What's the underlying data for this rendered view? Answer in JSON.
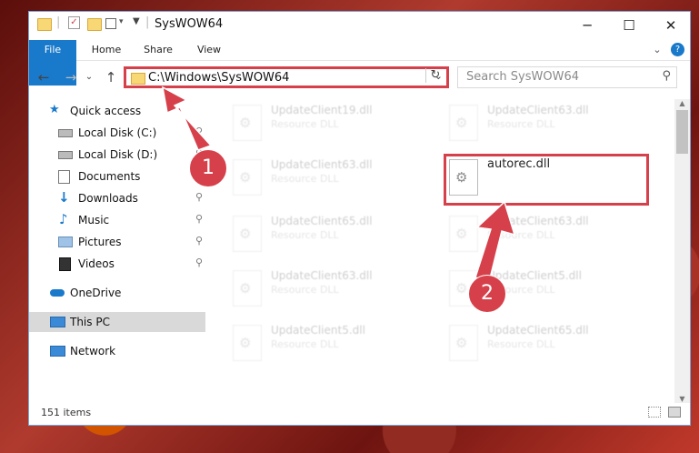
{
  "window": {
    "title": "SysWOW64",
    "minimize": "─",
    "maximize": "☐",
    "close": "✕"
  },
  "ribbon": {
    "tabs": [
      "File",
      "Home",
      "Share",
      "View"
    ],
    "collapse": "⌄",
    "help": "?"
  },
  "nav": {
    "back": "←",
    "forward": "→",
    "recent": "⌄",
    "up": "↑",
    "address": "C:\\Windows\\SysWOW64",
    "address_dropdown": "⌄",
    "refresh": "↻",
    "search_placeholder": "Search SysWOW64",
    "search_icon": "⚲"
  },
  "sidebar": {
    "items": [
      {
        "label": "Quick access",
        "icon": "star-icon"
      },
      {
        "label": "Local Disk (C:)",
        "icon": "drive-icon"
      },
      {
        "label": "Local Disk (D:)",
        "icon": "drive-icon"
      },
      {
        "label": "Documents",
        "icon": "documents-icon"
      },
      {
        "label": "Downloads",
        "icon": "download-icon"
      },
      {
        "label": "Music",
        "icon": "music-icon"
      },
      {
        "label": "Pictures",
        "icon": "pictures-icon"
      },
      {
        "label": "Videos",
        "icon": "videos-icon"
      },
      {
        "label": "OneDrive",
        "icon": "cloud-icon"
      },
      {
        "label": "This PC",
        "icon": "computer-icon"
      },
      {
        "label": "Network",
        "icon": "network-icon"
      }
    ],
    "pin": "📌"
  },
  "files": {
    "left": [
      {
        "name": "UpdateClient19.dll",
        "type": "Resource DLL"
      },
      {
        "name": "UpdateClient63.dll",
        "type": "Resource DLL"
      },
      {
        "name": "UpdateClient65.dll",
        "type": "Resource DLL"
      },
      {
        "name": "UpdateClient63.dll",
        "type": "Resource DLL"
      },
      {
        "name": "UpdateClient5.dll",
        "type": "Resource DLL"
      }
    ],
    "right": [
      {
        "name": "UpdateClient63.dll",
        "type": "Resource DLL"
      },
      {
        "name": "autorec.dll",
        "type": ""
      },
      {
        "name": "UpdateClient63.dll",
        "type": "Resource DLL"
      },
      {
        "name": "UpdateClient5.dll",
        "type": "Resource DLL"
      },
      {
        "name": "UpdateClient65.dll",
        "type": "Resource DLL"
      }
    ]
  },
  "status": {
    "item_count": "151 items"
  },
  "annotations": {
    "step1": "1",
    "step2": "2",
    "color": "#d6404a"
  }
}
